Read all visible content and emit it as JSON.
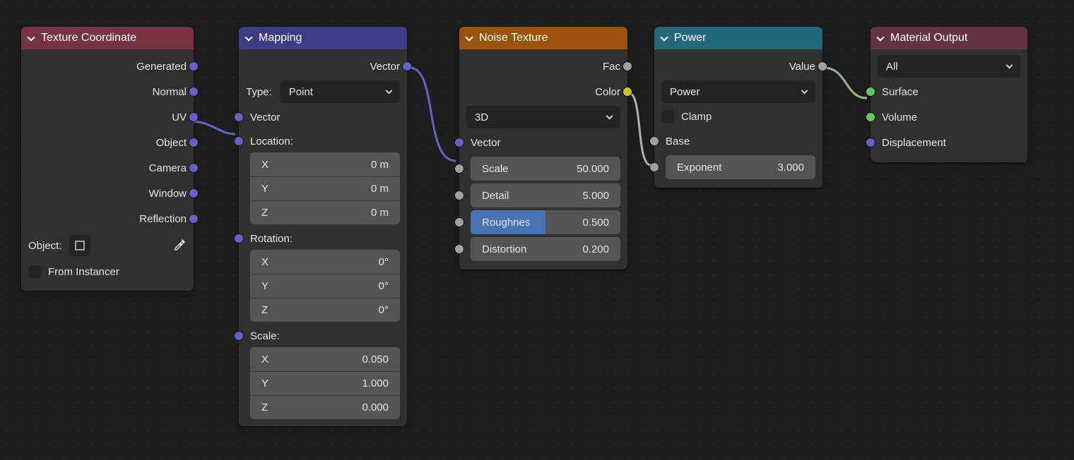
{
  "nodes": {
    "texcoord": {
      "title": "Texture Coordinate",
      "outputs": [
        "Generated",
        "Normal",
        "UV",
        "Object",
        "Camera",
        "Window",
        "Reflection"
      ],
      "object_label": "Object:",
      "from_instancer": "From Instancer"
    },
    "mapping": {
      "title": "Mapping",
      "out_vector": "Vector",
      "type_label": "Type:",
      "type_value": "Point",
      "in_vector": "Vector",
      "location_label": "Location:",
      "location": {
        "x_label": "X",
        "x_val": "0 m",
        "y_label": "Y",
        "y_val": "0 m",
        "z_label": "Z",
        "z_val": "0 m"
      },
      "rotation_label": "Rotation:",
      "rotation": {
        "x_label": "X",
        "x_val": "0°",
        "y_label": "Y",
        "y_val": "0°",
        "z_label": "Z",
        "z_val": "0°"
      },
      "scale_label": "Scale:",
      "scale": {
        "x_label": "X",
        "x_val": "0.050",
        "y_label": "Y",
        "y_val": "1.000",
        "z_label": "Z",
        "z_val": "0.000"
      }
    },
    "noise": {
      "title": "Noise Texture",
      "out_fac": "Fac",
      "out_color": "Color",
      "dim": "3D",
      "in_vector": "Vector",
      "scale_label": "Scale",
      "scale_val": "50.000",
      "detail_label": "Detail",
      "detail_val": "5.000",
      "rough_label": "Roughnes",
      "rough_val": "0.500",
      "distort_label": "Distortion",
      "distort_val": "0.200"
    },
    "power": {
      "title": "Power",
      "out_value": "Value",
      "op": "Power",
      "clamp": "Clamp",
      "in_base": "Base",
      "exp_label": "Exponent",
      "exp_val": "3.000"
    },
    "output": {
      "title": "Material Output",
      "target": "All",
      "in_surface": "Surface",
      "in_volume": "Volume",
      "in_displacement": "Displacement"
    }
  }
}
